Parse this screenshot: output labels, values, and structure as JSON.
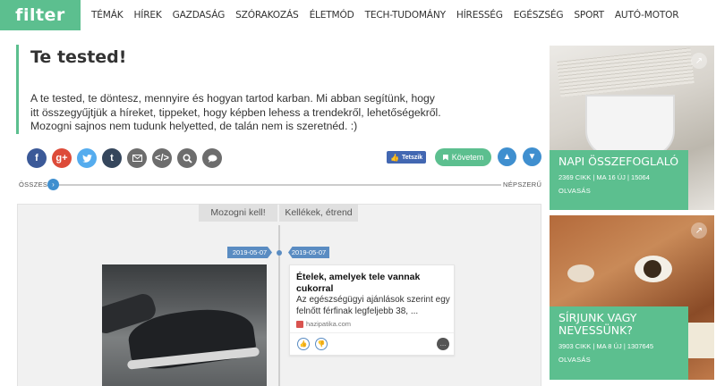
{
  "logo": "filter",
  "nav": [
    "TÉMÁK",
    "HÍREK",
    "GAZDASÁG",
    "SZÓRAKOZÁS",
    "ÉLETMÓD",
    "TECH-TUDOMÁNY",
    "HÍRESSÉG",
    "EGÉSZSÉG",
    "SPORT",
    "AUTÓ-MOTOR"
  ],
  "header": {
    "title": "Te tested!",
    "desc_lines": [
      "A te tested, te döntesz, mennyire és hogyan tartod karban. Mi abban segítünk, hogy",
      "itt összegyűjtjük a híreket, tippeket, hogy képben lehess a trendekről, lehetőségekről.",
      "Mozogni sajnos nem tudunk helyetted, de talán nem is szeretnéd. :)"
    ]
  },
  "share": {
    "like_label": "Tetszik",
    "follow_label": "Követem",
    "icons": [
      "facebook-icon",
      "google-plus-icon",
      "twitter-icon",
      "tumblr-icon",
      "mail-icon",
      "embed-icon",
      "search-icon",
      "comment-icon"
    ]
  },
  "slider": {
    "left": "ÖSSZES",
    "right": "NÉPSZERŰ"
  },
  "tabs": {
    "left": "Mozogni kell!",
    "right": "Kellékek, étrend"
  },
  "timeline": {
    "date_left": "2019-05-07",
    "date_right": "2019-05-07",
    "card": {
      "title": "Ételek, amelyek tele vannak cukorral",
      "text": "Az egészségügyi ajánlások szerint egy felnőtt férfinak legfeljebb 38, ...",
      "source": "hazipatika.com"
    }
  },
  "sidebar": [
    {
      "title": "NAPI ÖSSZEFOGLALÓ",
      "meta": "2369 CIKK | MA 16 ÚJ | 15064",
      "action": "OLVASÁS"
    },
    {
      "title": "SÍRJUNK VAGY NEVESSÜNK?",
      "meta": "3903 CIKK | MA 8 ÚJ | 1307645",
      "action": "OLVASÁS"
    }
  ],
  "colors": {
    "brand": "#5cbf8f",
    "accent_blue": "#3f8fcf",
    "facebook": "#3b5998",
    "google": "#dd4b39",
    "twitter": "#55acee"
  }
}
